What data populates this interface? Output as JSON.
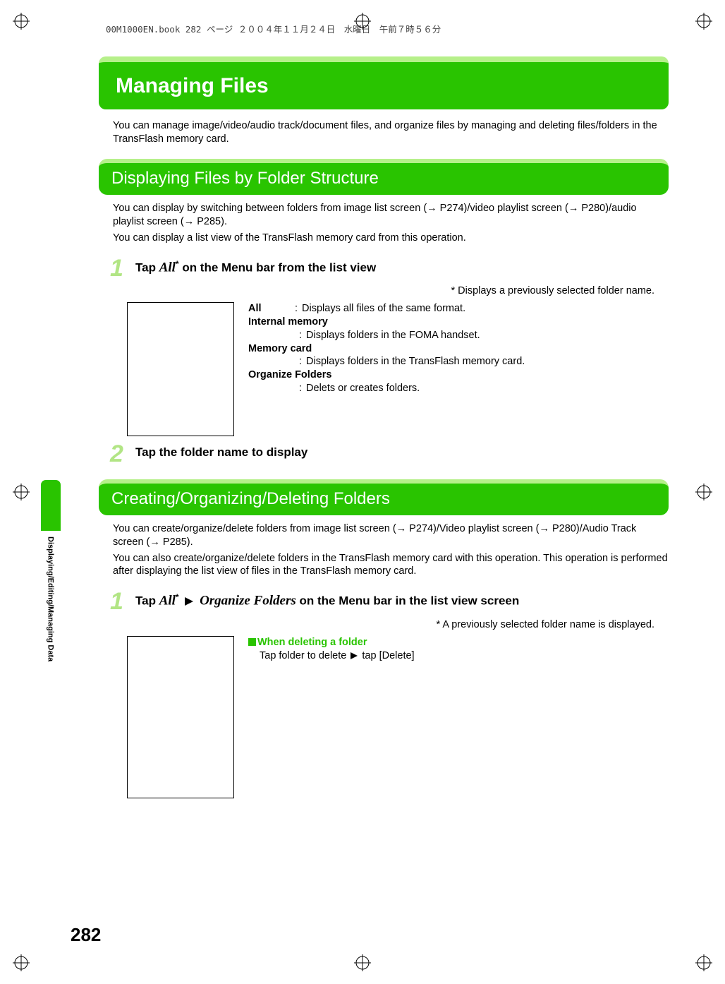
{
  "book_header": "00M1000EN.book  282 ページ  ２００４年１１月２４日　水曜日　午前７時５６分",
  "main_title": "Managing Files",
  "intro": "You can manage image/video/audio track/document files, and organize files by managing and deleting files/folders in the TransFlash memory card.",
  "section1": {
    "heading": "Displaying Files by Folder Structure",
    "body1": "You can display by switching between folders from image list screen (→ P274)/video playlist screen (→ P280)/audio playlist screen (→ P285).",
    "body2": "You can display a list view of the TransFlash memory card from this operation.",
    "step1_pre": "Tap ",
    "step1_italic": "All",
    "step1_post": " on the Menu bar from the list view",
    "step1_star": "*",
    "step1_note": "* Displays a previously selected folder name.",
    "defs": {
      "all_term": "All",
      "all_desc": "Displays all files of the same format.",
      "intmem_term": "Internal memory",
      "intmem_desc": "Displays folders in the FOMA handset.",
      "memcard_term": "Memory card",
      "memcard_desc": "Displays folders in the TransFlash memory card.",
      "org_term": "Organize Folders",
      "org_desc": "Delets or creates folders."
    },
    "step2": "Tap the folder name to display"
  },
  "section2": {
    "heading": "Creating/Organizing/Deleting Folders",
    "body1": "You can create/organize/delete folders from image list screen (→ P274)/Video playlist screen (→ P280)/Audio Track screen (→ P285).",
    "body2": "You can also create/organize/delete folders in the TransFlash memory card with this operation. This operation is performed after displaying the list view of files in the TransFlash memory card.",
    "step1_pre": "Tap ",
    "step1_italic1": "All",
    "step1_star": "*",
    "step1_italic2": "Organize Folders",
    "step1_post": " on the Menu bar in the list view screen",
    "step1_note": "* A previously selected folder name is displayed.",
    "del_heading": "When deleting a folder",
    "del_body_pre": "Tap folder to delete ",
    "del_body_post": " tap [Delete]"
  },
  "side_tab": "Displaying/Editing/Managing Data",
  "page_num": "282"
}
